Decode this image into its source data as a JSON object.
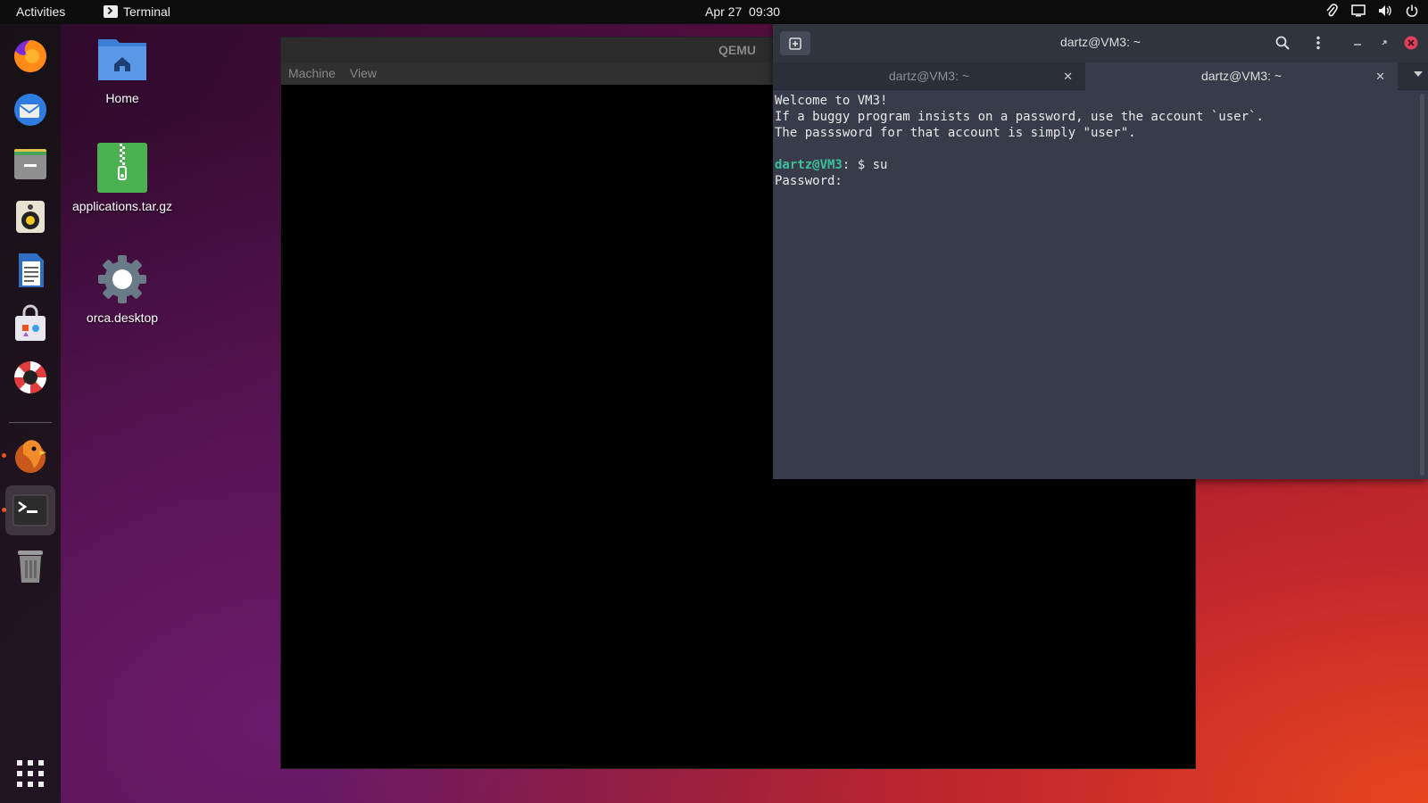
{
  "topbar": {
    "activities": "Activities",
    "app_name": "Terminal",
    "date": "Apr 27",
    "time": "09:30"
  },
  "dock": {
    "items": [
      "firefox",
      "thunderbird",
      "files",
      "rhythmbox",
      "writer",
      "software",
      "help",
      "app-gecko",
      "terminal",
      "trash"
    ]
  },
  "desktop": {
    "icons": [
      {
        "label": "Home"
      },
      {
        "label": "applications.tar.gz"
      },
      {
        "label": "orca.desktop"
      }
    ]
  },
  "qemu": {
    "title": "QEMU",
    "menu": [
      "Machine",
      "View"
    ]
  },
  "terminal": {
    "title": "dartz@VM3: ~",
    "tabs": [
      {
        "label": "dartz@VM3: ~",
        "active": false
      },
      {
        "label": "dartz@VM3: ~",
        "active": true
      }
    ],
    "lines": [
      "Welcome to VM3!",
      "If a buggy program insists on a password, use the account `user`.",
      "The passsword for that account is simply \"user\".",
      ""
    ],
    "prompt_user": "dartz@VM3",
    "prompt_rest": ": $ su",
    "password_line": "Password:"
  },
  "colors": {
    "accent": "#e95420",
    "prompt": "#3cc09a",
    "terminal_bg": "#383c4a"
  }
}
